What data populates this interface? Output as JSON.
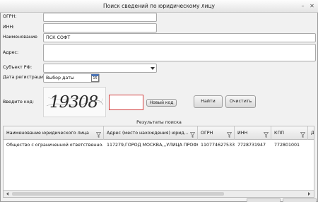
{
  "window": {
    "title": "Поиск сведений по юридическому лицу",
    "minimize_glyph": "–",
    "close_glyph": "✕"
  },
  "form": {
    "ogrn_label": "ОГРН:",
    "inn_label": "ИНН:",
    "name_label": "Наименование",
    "name_value": "ПСК СОФТ",
    "address_label": "Адрес:",
    "region_label": "Субъект РФ:",
    "regdate_label": "Дата регистрации:",
    "regdate_value": "Выбор даты",
    "calendar_day": "15",
    "captcha_label": "Введите код:",
    "captcha_text": "19308",
    "new_code_button": "Новый код",
    "find_button": "Найти",
    "clear_button": "Очистить"
  },
  "results": {
    "title": "Результаты поиска",
    "columns": [
      "Наименование юридического лица",
      "Адрес (место нахождения) юрид...",
      "ОГРН",
      "ИНН",
      "КПП",
      "Д"
    ],
    "rows": [
      [
        "Общество с ограниченной ответственно...",
        "117279,ГОРОД МОСКВА,,,УЛИЦА ПРОФС...",
        "1107746275339",
        "7728731947",
        "772801001",
        ""
      ]
    ]
  },
  "colors": {
    "accent_red": "#d23a3a",
    "window_bg": "#f1f1f1"
  },
  "icons": [
    "dropdown-arrow-icon",
    "calendar-icon",
    "filter-icon",
    "scroll-left-icon",
    "scroll-right-icon",
    "sort-indicator-icon"
  ]
}
